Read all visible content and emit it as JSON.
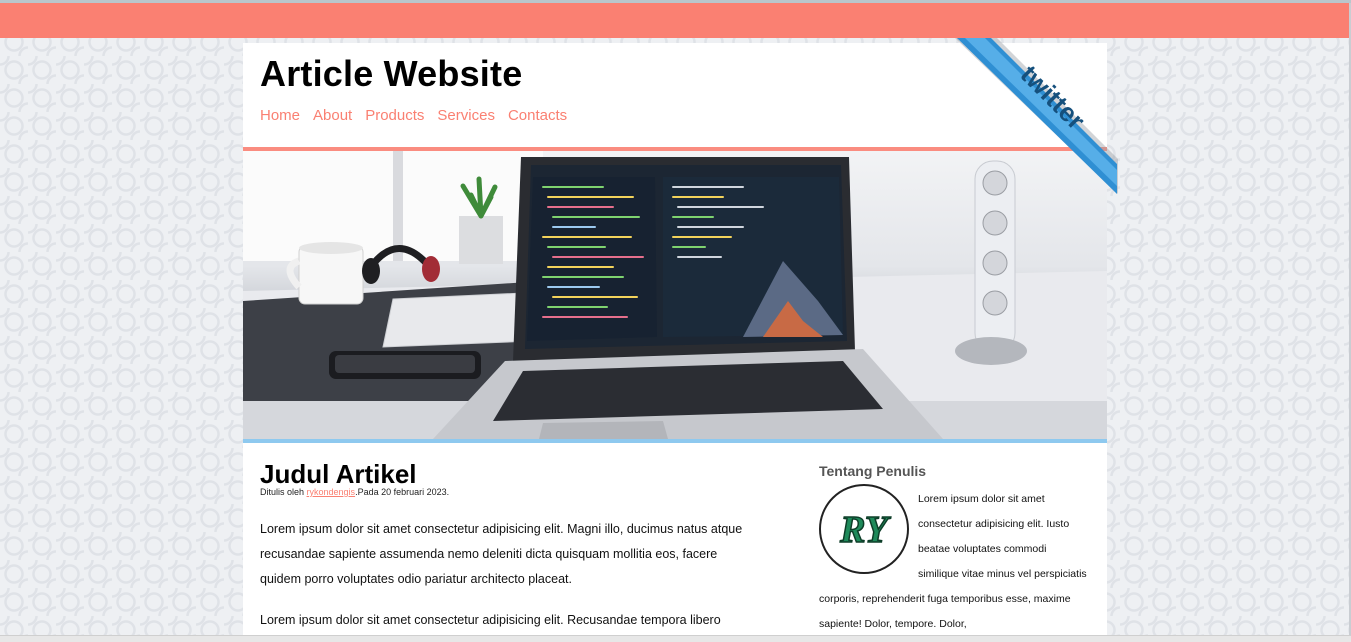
{
  "site": {
    "title": "Article Website",
    "nav": [
      "Home",
      "About",
      "Products",
      "Services",
      "Contacts"
    ]
  },
  "ribbon": {
    "label": "twitter"
  },
  "colors": {
    "accent": "#fa8072",
    "hero_border": "#8ec9ef"
  },
  "article": {
    "title": "Judul Artikel",
    "meta_prefix": "Ditulis oleh ",
    "author": "rykondengis",
    "meta_suffix": ".Pada 20 februari 2023.",
    "paragraphs": [
      "Lorem ipsum dolor sit amet consectetur adipisicing elit. Magni illo, ducimus natus atque recusandae sapiente assumenda nemo deleniti dicta quisquam mollitia eos, facere quidem porro voluptates odio pariatur architecto placeat.",
      "Lorem ipsum dolor sit amet consectetur adipisicing elit. Recusandae tempora libero"
    ]
  },
  "sidebar": {
    "title": "Tentang Penulis",
    "logo_text": "RY",
    "bio": "Lorem ipsum dolor sit amet consectetur adipisicing elit. Iusto beatae voluptates commodi similique vitae minus vel perspiciatis corporis, reprehenderit fuga temporibus esse, maxime sapiente! Dolor, tempore. Dolor,"
  }
}
